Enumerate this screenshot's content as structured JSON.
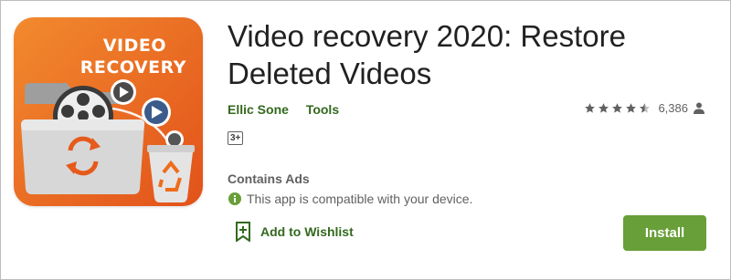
{
  "app": {
    "title_line1": "Video recovery 2020: Restore",
    "title_line2": "Deleted Videos",
    "developer": "Ellic Sone",
    "category": "Tools",
    "rating_value": 4.5,
    "rating_count": "6,386",
    "content_rating": "3+",
    "contains_ads": "Contains Ads",
    "compatibility": "This app is compatible with your device.",
    "wishlist_label": "Add to Wishlist",
    "install_label": "Install"
  },
  "icon": {
    "text_line1": "VIDEO",
    "text_line2": "RECOVERY",
    "background": "#ef6c1a",
    "accent_dark": "#d84315"
  },
  "colors": {
    "brand_green": "#33691e",
    "install_green": "#689f38",
    "text_primary": "#212121",
    "text_secondary": "#616161"
  }
}
